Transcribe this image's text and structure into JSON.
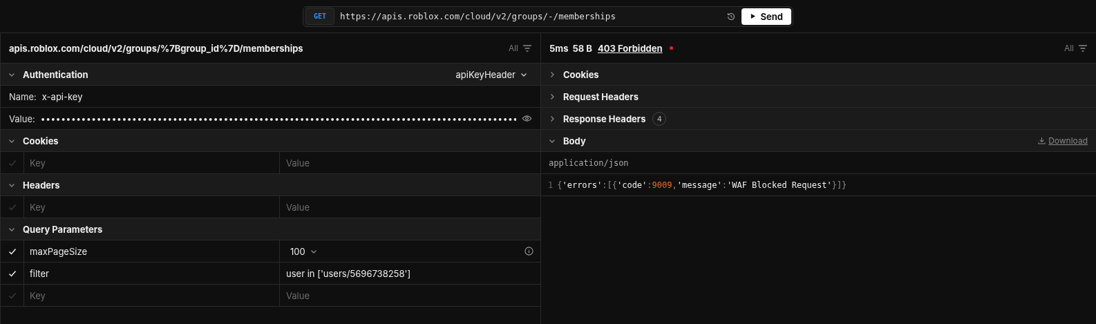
{
  "url_bar": {
    "method": "GET",
    "url": "https://apis.roblox.com/cloud/v2/groups/-/memberships",
    "send": "Send"
  },
  "request": {
    "path": "apis.roblox.com/cloud/v2/groups/%7Bgroup_id%7D/memberships",
    "filter": "All",
    "auth": {
      "title": "Authentication",
      "expanded": true,
      "scheme": "apiKeyHeader",
      "name_label": "Name:",
      "name_value": "x-api-key",
      "value_label": "Value:",
      "value": "••••••••••••••••••••••••••••••••••••••••••••••••••••••••••••••••••••••••••••••••••••••••••••••"
    },
    "sections": [
      {
        "title": "Cookies",
        "expanded": true,
        "rows": [
          {
            "kind": "empty",
            "checked": false,
            "key": "Key",
            "value": "Value"
          }
        ]
      },
      {
        "title": "Headers",
        "expanded": true,
        "rows": [
          {
            "kind": "empty",
            "checked": false,
            "key": "Key",
            "value": "Value"
          }
        ]
      },
      {
        "title": "Query Parameters",
        "expanded": true,
        "rows": [
          {
            "kind": "select",
            "checked": true,
            "key": "maxPageSize",
            "value": "100"
          },
          {
            "kind": "param",
            "checked": true,
            "key": "filter",
            "value": "user in ['users/5696738258']"
          },
          {
            "kind": "empty",
            "checked": false,
            "key": "Key",
            "value": "Value"
          }
        ]
      }
    ]
  },
  "response": {
    "time": "5ms",
    "size": "58 B",
    "status": "403 Forbidden",
    "filter": "All",
    "sections": [
      {
        "title": "Cookies",
        "expanded": false
      },
      {
        "title": "Request Headers",
        "expanded": false
      },
      {
        "title": "Response Headers",
        "expanded": false,
        "count": "4"
      },
      {
        "title": "Body",
        "expanded": true,
        "action": "Download"
      }
    ],
    "content_type": "application/json",
    "lines": [
      {
        "number": "1",
        "tokens": [
          {
            "kind": "punct",
            "text": "{"
          },
          {
            "kind": "string",
            "text": "'errors'"
          },
          {
            "kind": "punct",
            "text": ":[{"
          },
          {
            "kind": "string",
            "text": "'code'"
          },
          {
            "kind": "punct",
            "text": ":"
          },
          {
            "kind": "number",
            "text": "9009"
          },
          {
            "kind": "punct",
            "text": ","
          },
          {
            "kind": "string",
            "text": "'message'"
          },
          {
            "kind": "punct",
            "text": ":"
          },
          {
            "kind": "string",
            "text": "'WAF Blocked Request'"
          },
          {
            "kind": "punct",
            "text": "}]}"
          }
        ]
      }
    ]
  }
}
